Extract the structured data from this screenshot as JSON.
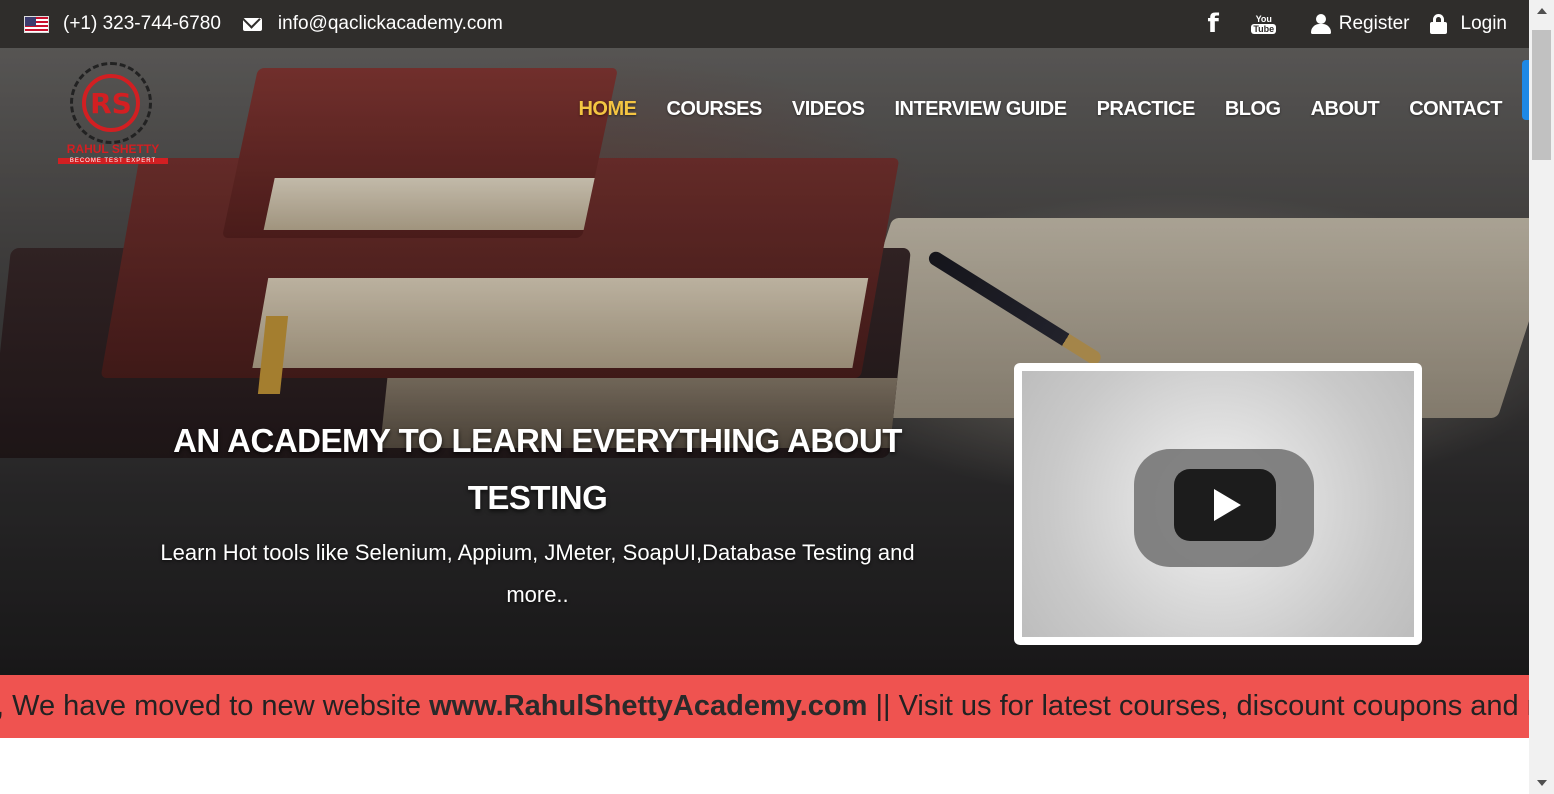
{
  "topbar": {
    "phone": "(+1) 323-744-6780",
    "email": "info@qaclickacademy.com",
    "youtube_icon_text_top": "You",
    "youtube_icon_text_bottom": "Tube",
    "register_label": "Register",
    "login_label": "Login"
  },
  "logo": {
    "monogram": "RS",
    "name": "RAHUL SHETTY",
    "tagline": "BECOME TEST EXPERT"
  },
  "nav": {
    "items": [
      {
        "label": "HOME",
        "active": true
      },
      {
        "label": "COURSES"
      },
      {
        "label": "VIDEOS"
      },
      {
        "label": "INTERVIEW GUIDE"
      },
      {
        "label": "PRACTICE"
      },
      {
        "label": "BLOG"
      },
      {
        "label": "ABOUT"
      },
      {
        "label": "CONTACT"
      }
    ]
  },
  "hero": {
    "headline": "AN ACADEMY TO LEARN EVERYTHING ABOUT TESTING",
    "subline": "Learn Hot tools like Selenium, Appium, JMeter, SoapUI,Database Testing and more.."
  },
  "marquee": {
    "prefix": ", We have moved to new website ",
    "site": "www.RahulShettyAcademy.com",
    "suffix": " || Visit us for latest courses, discount coupons and m"
  },
  "colors": {
    "topbar_bg": "#2f2d2b",
    "nav_active": "#f4c542",
    "brand_red": "#d21f22",
    "marquee_bg": "#ef5350"
  },
  "icons": [
    "us-flag-icon",
    "envelope-icon",
    "facebook-icon",
    "youtube-icon",
    "user-icon",
    "lock-icon",
    "play-icon"
  ]
}
